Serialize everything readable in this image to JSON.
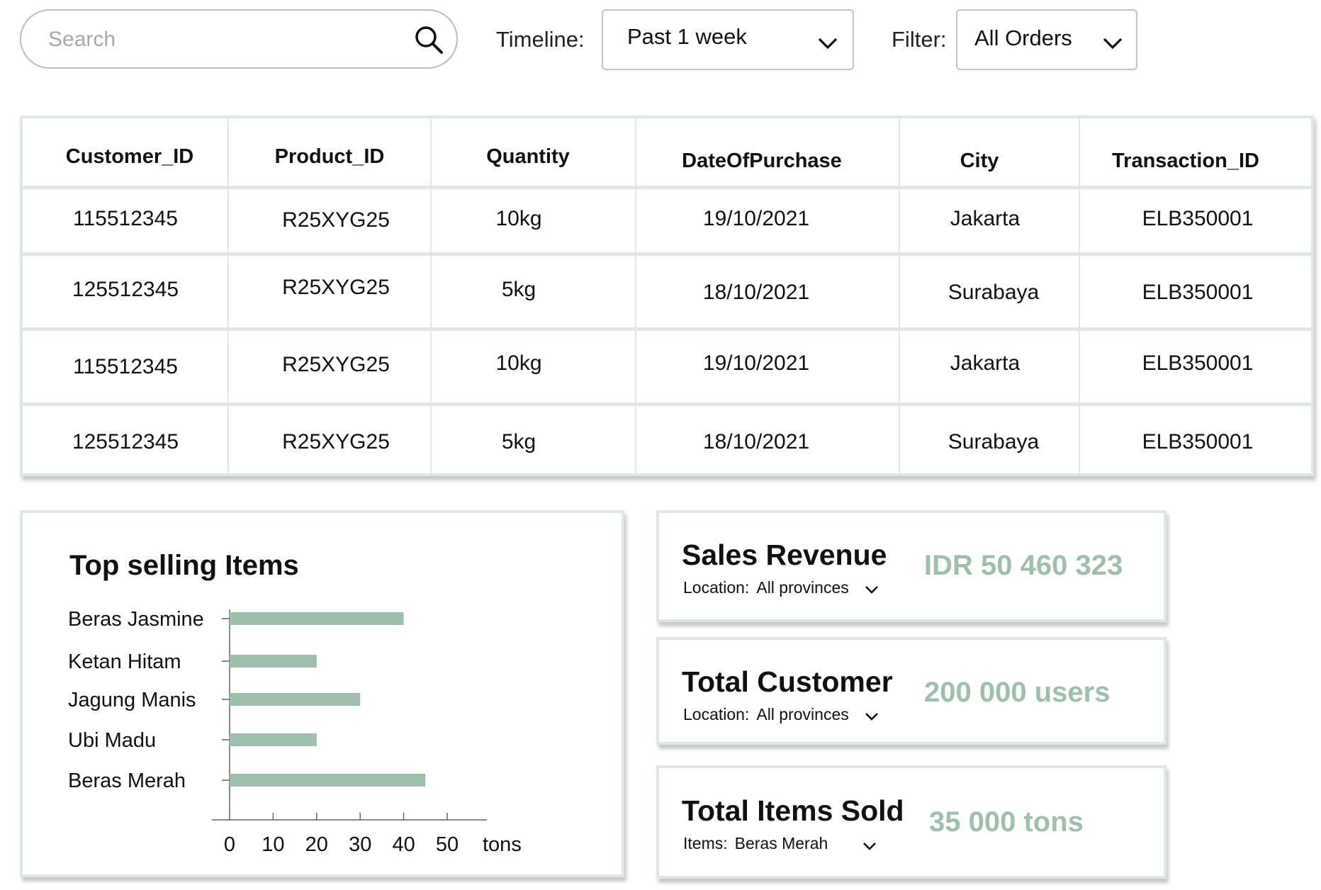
{
  "search": {
    "placeholder": "Search",
    "icon": "search-icon"
  },
  "timeline": {
    "label": "Timeline:",
    "value": "Past 1 week"
  },
  "filter": {
    "label": "Filter:",
    "value": "All Orders"
  },
  "table": {
    "columns": [
      "Customer_ID",
      "Product_ID",
      "Quantity",
      "DateOfPurchase",
      "City",
      "Transaction_ID"
    ],
    "rows": [
      [
        "115512345",
        "R25XYG25",
        "10kg",
        "19/10/2021",
        "Jakarta",
        "ELB350001"
      ],
      [
        "125512345",
        "R25XYG25",
        "5kg",
        "18/10/2021",
        "Surabaya",
        "ELB350001"
      ],
      [
        "115512345",
        "R25XYG25",
        "10kg",
        "19/10/2021",
        "Jakarta",
        "ELB350001"
      ],
      [
        "125512345",
        "R25XYG25",
        "5kg",
        "18/10/2021",
        "Surabaya",
        "ELB350001"
      ]
    ]
  },
  "top_selling": {
    "title": "Top selling Items"
  },
  "chart_data": {
    "type": "bar",
    "orientation": "horizontal",
    "title": "Top selling Items",
    "categories": [
      "Beras Jasmine",
      "Ketan Hitam",
      "Jagung Manis",
      "Ubi Madu",
      "Beras Merah"
    ],
    "values": [
      40,
      20,
      30,
      20,
      45
    ],
    "xlabel": "tons",
    "xlim": [
      0,
      50
    ],
    "xticks": [
      0,
      10,
      20,
      30,
      40,
      50
    ],
    "grid": false,
    "bar_color": "#9fbfad"
  },
  "stats": {
    "revenue": {
      "title": "Sales Revenue",
      "sub_label": "Location:",
      "sub_value": "All provinces",
      "value": "IDR 50 460 323"
    },
    "customers": {
      "title": "Total Customer",
      "sub_label": "Location:",
      "sub_value": "All provinces",
      "value": "200 000 users"
    },
    "items": {
      "title": "Total Items Sold",
      "sub_label": "Items:",
      "sub_value": "Beras Merah",
      "value": "35 000 tons"
    }
  },
  "colors": {
    "accent": "#9fbfad",
    "card_border": "#dfe7e2"
  }
}
